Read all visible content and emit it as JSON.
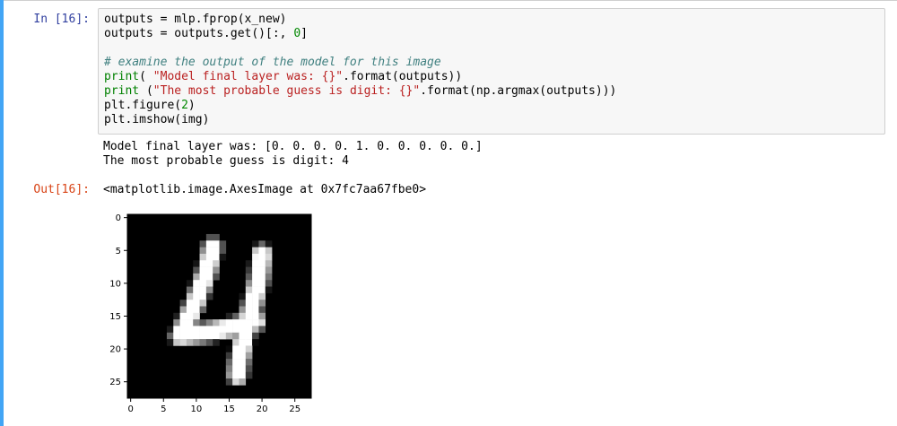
{
  "cell": {
    "in_prompt": "In [16]:",
    "out_prompt": "Out[16]:",
    "code_lines": [
      "outputs = mlp.fprop(x_new)",
      "outputs = outputs.get()[:, 0]",
      "",
      "# examine the output of the model for this image",
      "print( \"Model final layer was: {}\".format(outputs))",
      "print (\"The most probable guess is digit: {}\".format(np.argmax(outputs)))",
      "plt.figure(2)",
      "plt.imshow(img)"
    ],
    "stdout_lines": [
      "Model final layer was: [0. 0. 0. 0. 1. 0. 0. 0. 0. 0.]",
      "The most probable guess is digit: 4"
    ],
    "out_repr": "<matplotlib.image.AxesImage at 0x7fc7aa67fbe0>"
  },
  "figure": {
    "image_label": "handwritten digit 4 (MNIST, grayscale)",
    "y_ticks": [
      "0",
      "5",
      "10",
      "15",
      "20",
      "25"
    ],
    "x_ticks": [
      "0",
      "5",
      "10",
      "15",
      "20",
      "25"
    ]
  }
}
